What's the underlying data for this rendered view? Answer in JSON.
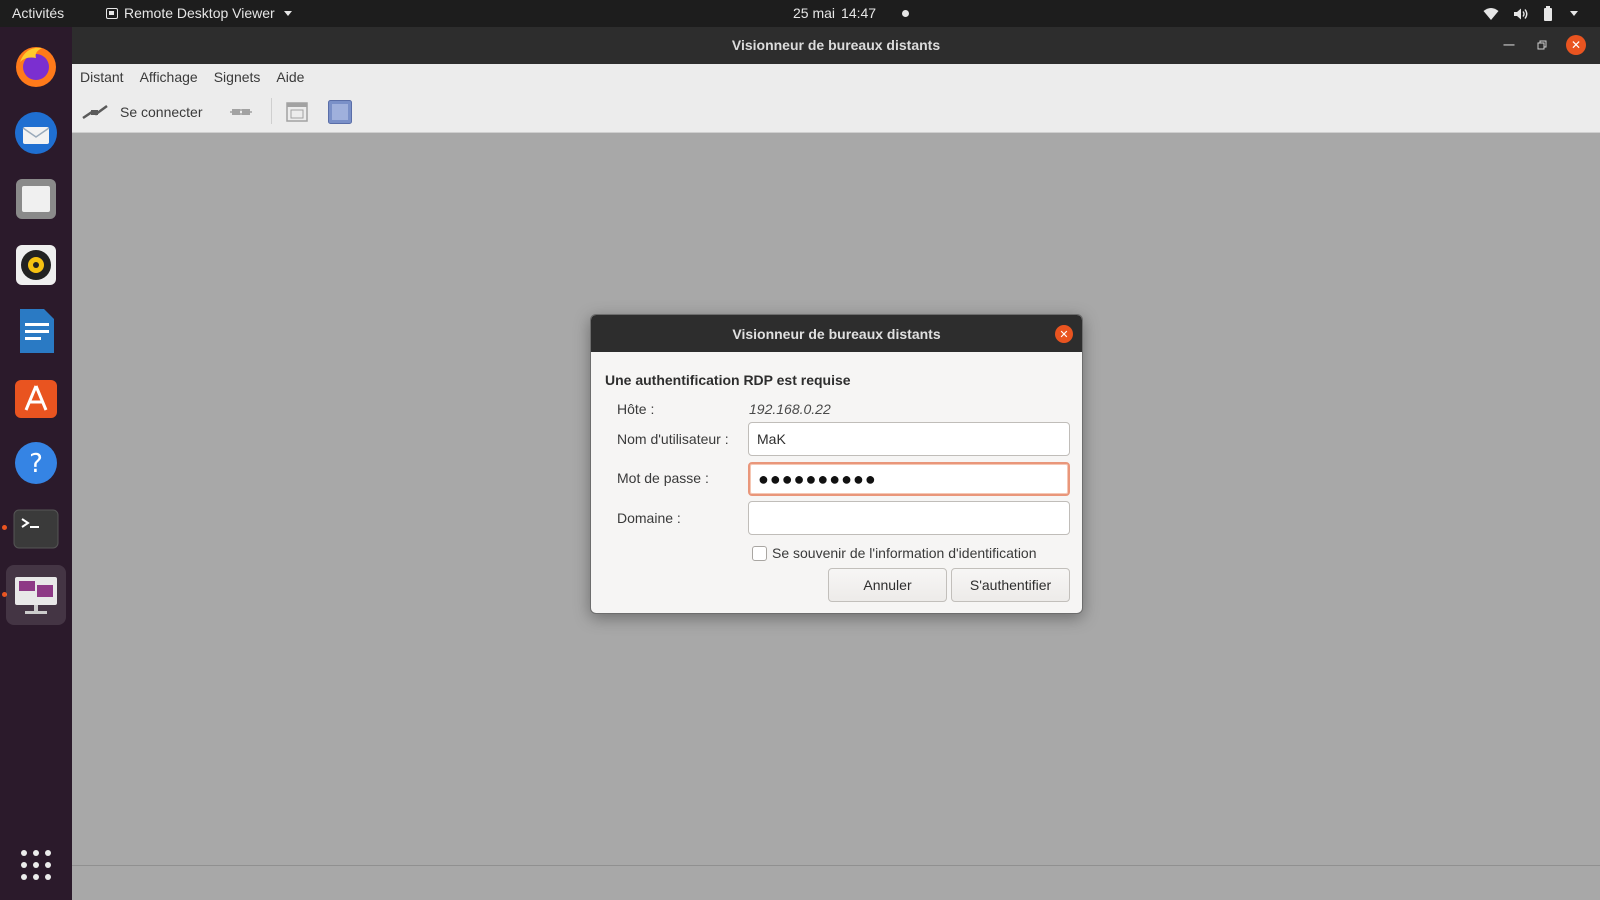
{
  "topbar": {
    "activities": "Activités",
    "app_menu": "Remote Desktop Viewer",
    "date": "25 mai",
    "time": "14:47",
    "tray_icons": [
      "wifi-icon",
      "volume-icon",
      "battery-icon",
      "chevron-down-icon"
    ]
  },
  "dock": {
    "items": [
      "firefox-icon",
      "thunderbird-icon",
      "files-icon",
      "rhythmbox-icon",
      "writer-icon",
      "software-icon",
      "help-icon",
      "terminal-icon",
      "remote-desktop-icon",
      "app-grid-icon"
    ]
  },
  "window": {
    "title": "Visionneur de bureaux distants",
    "menu": [
      "Distant",
      "Affichage",
      "Signets",
      "Aide"
    ],
    "toolbar": {
      "connect_label": "Se connecter"
    }
  },
  "dialog": {
    "title": "Visionneur de bureaux distants",
    "heading": "Une authentification RDP est requise",
    "host_label": "Hôte :",
    "host_value": "192.168.0.22",
    "username_label": "Nom d'utilisateur :",
    "username_value": "MaK",
    "password_label": "Mot de passe :",
    "password_value": "●●●●●●●●●●",
    "domain_label": "Domaine :",
    "domain_value": "",
    "remember_label": "Se souvenir de l'information d'identification",
    "remember_checked": false,
    "cancel_label": "Annuler",
    "auth_label": "S'authentifier"
  },
  "colors": {
    "accent": "#e95420",
    "dock_bg": "#2b1a2b",
    "titlebar_bg": "#2d2d2d",
    "viewport_bg": "#a8a8a8"
  }
}
